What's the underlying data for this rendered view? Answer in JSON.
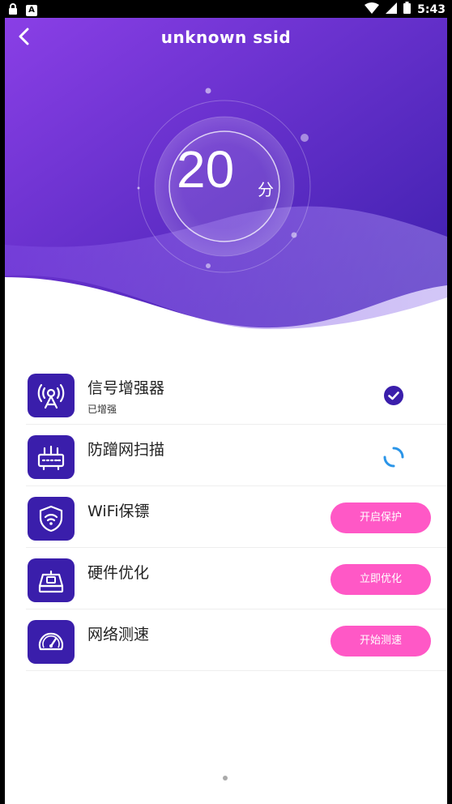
{
  "status_bar": {
    "time": "5:43",
    "left_icon_label": "A"
  },
  "header": {
    "title": "unknown ssid",
    "back_icon": "chevron-left-icon"
  },
  "score": {
    "value": "20",
    "unit": "分"
  },
  "features": [
    {
      "title": "信号增强器",
      "subtitle": "已增强",
      "status": "check",
      "icon": "antenna-icon"
    },
    {
      "title": "防蹭网扫描",
      "status": "loading",
      "icon": "router-icon"
    },
    {
      "title": "WiFi保镖",
      "action": "开启保护",
      "icon": "wifi-shield-icon"
    },
    {
      "title": "硬件优化",
      "action": "立即优化",
      "icon": "hardware-icon"
    },
    {
      "title": "网络测速",
      "action": "开始测速",
      "icon": "speedometer-icon"
    }
  ],
  "colors": {
    "gradient_start": "#8a3fe6",
    "gradient_end": "#3a1eab",
    "icon_tile": "#3a1eab",
    "action_pill": "#ff58c6"
  }
}
